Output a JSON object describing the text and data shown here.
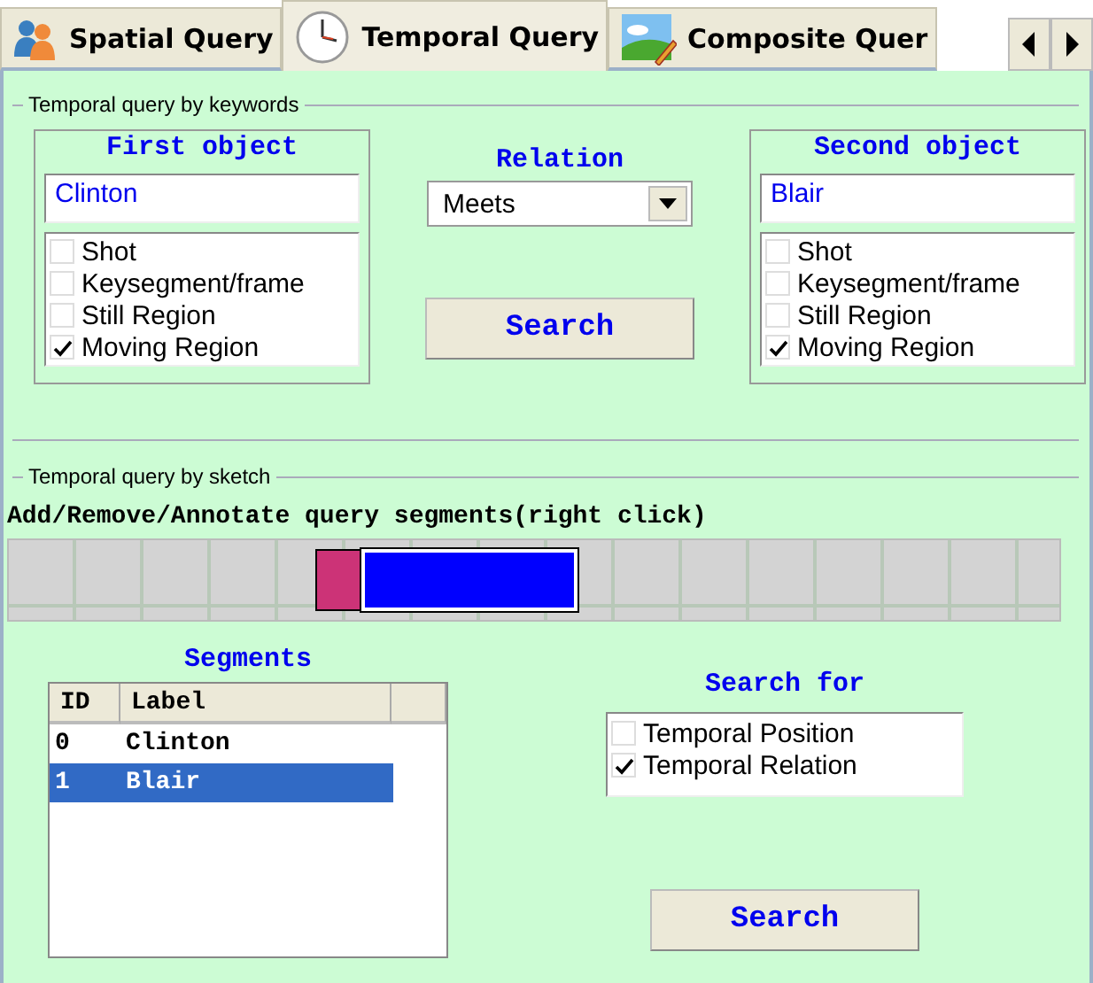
{
  "tabs": [
    {
      "label": "Spatial Query",
      "selected": false
    },
    {
      "label": "Temporal Query",
      "selected": true
    },
    {
      "label": "Composite Quer",
      "selected": false
    }
  ],
  "keyword_query": {
    "title": "Temporal query by keywords",
    "first_object": {
      "title": "First object",
      "value": "Clinton",
      "types": [
        {
          "label": "Shot",
          "checked": false
        },
        {
          "label": "Keysegment/frame",
          "checked": false
        },
        {
          "label": "Still Region",
          "checked": false
        },
        {
          "label": "Moving Region",
          "checked": true
        }
      ]
    },
    "relation": {
      "title": "Relation",
      "value": "Meets"
    },
    "search_button": "Search",
    "second_object": {
      "title": "Second object",
      "value": "Blair",
      "types": [
        {
          "label": "Shot",
          "checked": false
        },
        {
          "label": "Keysegment/frame",
          "checked": false
        },
        {
          "label": "Still Region",
          "checked": false
        },
        {
          "label": "Moving Region",
          "checked": true
        }
      ]
    }
  },
  "sketch_query": {
    "title": "Temporal query by sketch",
    "hint": "Add/Remove/Annotate query segments(right click)",
    "timeline_segments": [
      {
        "color": "#cc3377",
        "selected": false
      },
      {
        "color": "#0000ff",
        "selected": true
      }
    ],
    "segments": {
      "title": "Segments",
      "columns": [
        "ID",
        "Label"
      ],
      "rows": [
        {
          "id": "0",
          "label": "Clinton",
          "selected": false
        },
        {
          "id": "1",
          "label": "Blair",
          "selected": true
        }
      ]
    },
    "search_for": {
      "title": "Search for",
      "options": [
        {
          "label": "Temporal Position",
          "checked": false
        },
        {
          "label": "Temporal Relation",
          "checked": true
        }
      ]
    },
    "search_button": "Search"
  }
}
